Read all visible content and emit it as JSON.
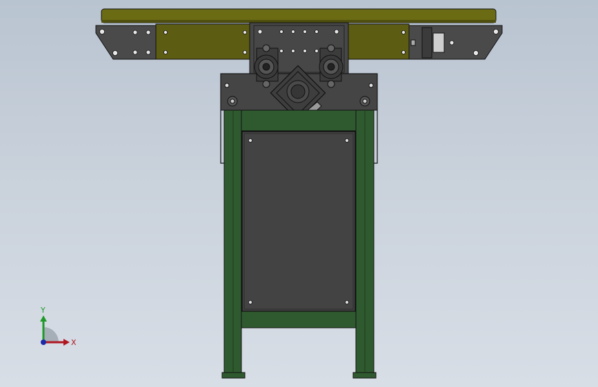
{
  "viewport": {
    "background_top": "#b9c4d1",
    "background_bottom": "#d8dee6"
  },
  "model": {
    "belt_color": "#5c5c12",
    "belt_edge_color": "#6b6b14",
    "dark_plate_color": "#4a4a4a",
    "panel_color": "#434343",
    "frame_color": "#2f5a2f",
    "frame_edge_color": "#1e3b1e",
    "outline_color": "#111111"
  },
  "triad": {
    "x_label": "X",
    "y_label": "Y",
    "x_color": "#b0171f",
    "y_color": "#1f9a2a",
    "z_color": "#1d2aa8"
  }
}
